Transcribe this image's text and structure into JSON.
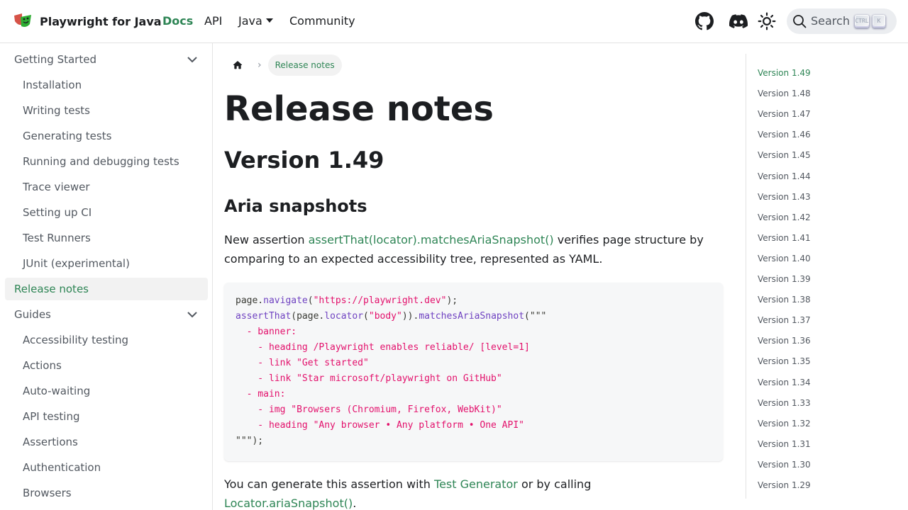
{
  "navbar": {
    "title": "Playwright for Java",
    "links": [
      {
        "label": "Docs",
        "active": true
      },
      {
        "label": "API",
        "active": false
      },
      {
        "label": "Java",
        "active": false,
        "dropdown": true
      },
      {
        "label": "Community",
        "active": false
      }
    ],
    "icons": [
      "github-icon",
      "discord-icon",
      "theme-toggle-icon"
    ],
    "search": {
      "label": "Search",
      "kbd1": "CTRL",
      "kbd2": "K"
    }
  },
  "sidebar": {
    "items": [
      {
        "label": "Getting Started",
        "type": "category",
        "expanded": true
      },
      {
        "label": "Installation",
        "type": "sub"
      },
      {
        "label": "Writing tests",
        "type": "sub"
      },
      {
        "label": "Generating tests",
        "type": "sub"
      },
      {
        "label": "Running and debugging tests",
        "type": "sub"
      },
      {
        "label": "Trace viewer",
        "type": "sub"
      },
      {
        "label": "Setting up CI",
        "type": "sub"
      },
      {
        "label": "Test Runners",
        "type": "sub"
      },
      {
        "label": "JUnit (experimental)",
        "type": "sub"
      },
      {
        "label": "Release notes",
        "type": "category",
        "active": true
      },
      {
        "label": "Guides",
        "type": "category",
        "expanded": true
      },
      {
        "label": "Accessibility testing",
        "type": "sub"
      },
      {
        "label": "Actions",
        "type": "sub"
      },
      {
        "label": "Auto-waiting",
        "type": "sub"
      },
      {
        "label": "API testing",
        "type": "sub"
      },
      {
        "label": "Assertions",
        "type": "sub"
      },
      {
        "label": "Authentication",
        "type": "sub"
      },
      {
        "label": "Browsers",
        "type": "sub"
      }
    ]
  },
  "breadcrumb": {
    "current": "Release notes"
  },
  "article": {
    "title": "Release notes",
    "version_heading": "Version 1.49",
    "section_heading": "Aria snapshots",
    "intro": {
      "before": "New assertion ",
      "link": "assertThat(locator).matchesAriaSnapshot()",
      "after": " verifies page structure by comparing to an expected accessibility tree, represented as YAML."
    },
    "code_lines": [
      [
        {
          "t": "page.",
          "c": "p"
        },
        {
          "t": "navigate",
          "c": "fn"
        },
        {
          "t": "(",
          "c": "p"
        },
        {
          "t": "\"https://playwright.dev\"",
          "c": "str"
        },
        {
          "t": ");",
          "c": "p"
        }
      ],
      [
        {
          "t": "assertThat",
          "c": "fn"
        },
        {
          "t": "(page.",
          "c": "p"
        },
        {
          "t": "locator",
          "c": "fn"
        },
        {
          "t": "(",
          "c": "p"
        },
        {
          "t": "\"body\"",
          "c": "str"
        },
        {
          "t": ")).",
          "c": "p"
        },
        {
          "t": "matchesAriaSnapshot",
          "c": "fn"
        },
        {
          "t": "(\"\"\"",
          "c": "p"
        }
      ],
      [
        {
          "t": "  - banner:",
          "c": "str"
        }
      ],
      [
        {
          "t": "    - heading /Playwright enables reliable/ [level=1]",
          "c": "str"
        }
      ],
      [
        {
          "t": "    - link \"Get started\"",
          "c": "str"
        }
      ],
      [
        {
          "t": "    - link \"Star microsoft/playwright on GitHub\"",
          "c": "str"
        }
      ],
      [
        {
          "t": "  - main:",
          "c": "str"
        }
      ],
      [
        {
          "t": "    - img \"Browsers (Chromium, Firefox, WebKit)\"",
          "c": "str"
        }
      ],
      [
        {
          "t": "    - heading \"Any browser • Any platform • One API\"",
          "c": "str"
        }
      ],
      [
        {
          "t": "\"\"\");",
          "c": "p"
        }
      ]
    ],
    "outro": {
      "before": "You can generate this assertion with ",
      "link1": "Test Generator",
      "middle": " or by calling ",
      "link2": "Locator.ariaSnapshot()",
      "after": "."
    }
  },
  "toc": {
    "items": [
      "Version 1.49",
      "Version 1.48",
      "Version 1.47",
      "Version 1.46",
      "Version 1.45",
      "Version 1.44",
      "Version 1.43",
      "Version 1.42",
      "Version 1.41",
      "Version 1.40",
      "Version 1.39",
      "Version 1.38",
      "Version 1.37",
      "Version 1.36",
      "Version 1.35",
      "Version 1.34",
      "Version 1.33",
      "Version 1.32",
      "Version 1.31",
      "Version 1.30",
      "Version 1.29"
    ],
    "active_index": 0
  },
  "colors": {
    "accent": "#2e8555",
    "text": "#1c1e21",
    "muted": "#525860",
    "code_fn": "#6f42c1",
    "code_str": "#e3116c"
  }
}
